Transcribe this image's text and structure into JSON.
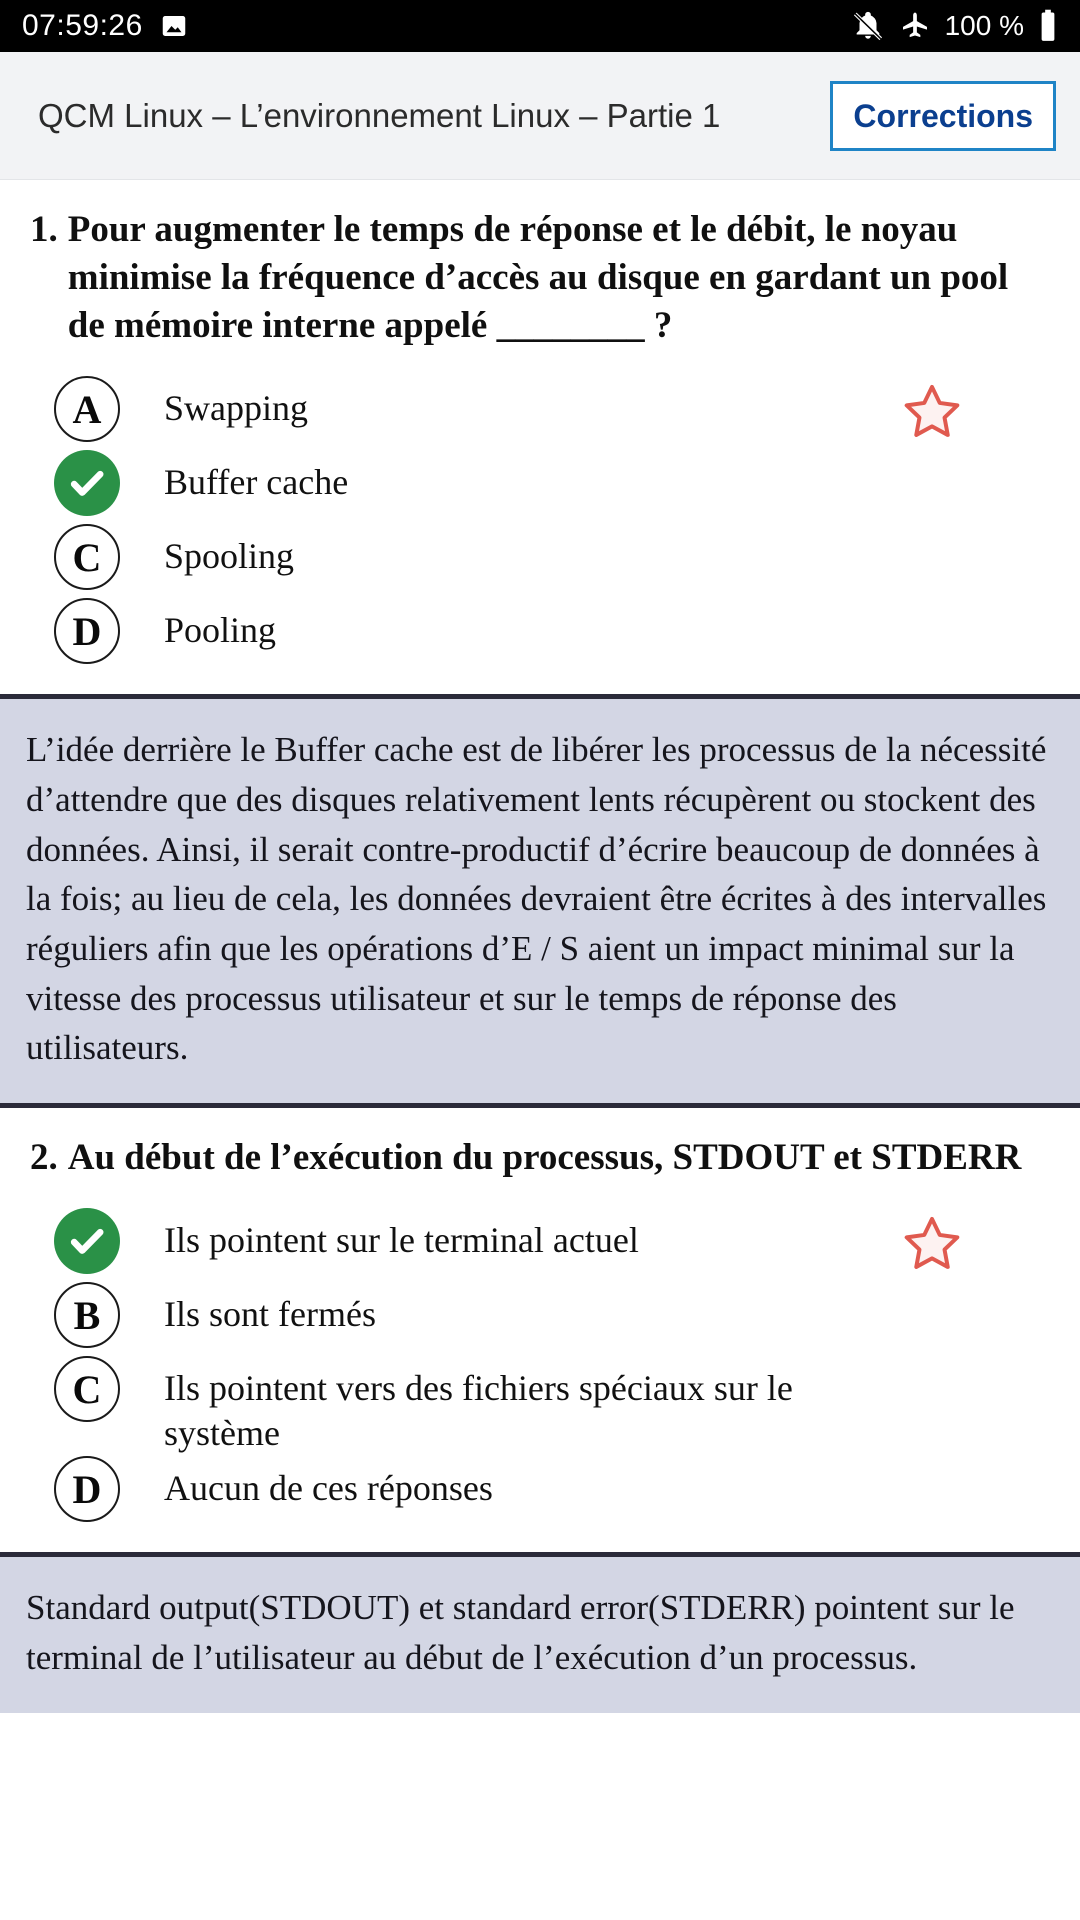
{
  "status_bar": {
    "clock": "07:59:26",
    "battery_percent": "100 %",
    "icons": [
      "image-icon",
      "bell-off-icon",
      "airplane-mode-icon",
      "battery-full-icon"
    ]
  },
  "header": {
    "title": "QCM Linux – L’environnement Linux – Partie 1",
    "corrections_label": "Corrections",
    "accent_border": "#1f84c6",
    "accent_text": "#0b3f8f"
  },
  "colors": {
    "correct_green": "#2a9147",
    "star_red": "#e05a4f",
    "explanation_bg": "#d3d6e4",
    "explanation_border": "#2b2b3a",
    "header_bg": "#f2f3f5"
  },
  "questions": [
    {
      "number": "1.",
      "text": "Pour augmenter le temps de réponse et le débit, le noyau minimise la fréquence d’accès au disque en gardant un pool de mémoire interne appelé ________ ?",
      "options": [
        {
          "letter": "A",
          "label": "Swapping",
          "correct": false,
          "starred": true
        },
        {
          "letter": "B",
          "label": "Buffer cache",
          "correct": true,
          "starred": false
        },
        {
          "letter": "C",
          "label": "Spooling",
          "correct": false,
          "starred": false
        },
        {
          "letter": "D",
          "label": "Pooling",
          "correct": false,
          "starred": false
        }
      ],
      "explanation": "L’idée derrière le Buffer cache est de libérer les processus de la nécessité d’attendre que des disques relativement lents récupèrent ou stockent des données. Ainsi, il serait contre-productif d’écrire beaucoup de données à la fois; au lieu de cela, les données devraient être écrites à des intervalles réguliers afin que les opérations d’E / S aient un impact minimal sur la vitesse des processus utilisateur et sur le temps de réponse des utilisateurs."
    },
    {
      "number": "2.",
      "text": "Au début de l’exécution du processus, STDOUT et STDERR",
      "options": [
        {
          "letter": "A",
          "label": "Ils pointent sur le terminal actuel",
          "correct": true,
          "starred": true
        },
        {
          "letter": "B",
          "label": "Ils sont fermés",
          "correct": false,
          "starred": false
        },
        {
          "letter": "C",
          "label": "Ils pointent vers des fichiers spéciaux sur le système",
          "correct": false,
          "starred": false
        },
        {
          "letter": "D",
          "label": "Aucun de ces réponses",
          "correct": false,
          "starred": false
        }
      ],
      "explanation": "Standard output(STDOUT) et standard error(STDERR) pointent sur le terminal de l’utilisateur au début de l’exécution d’un processus."
    }
  ]
}
